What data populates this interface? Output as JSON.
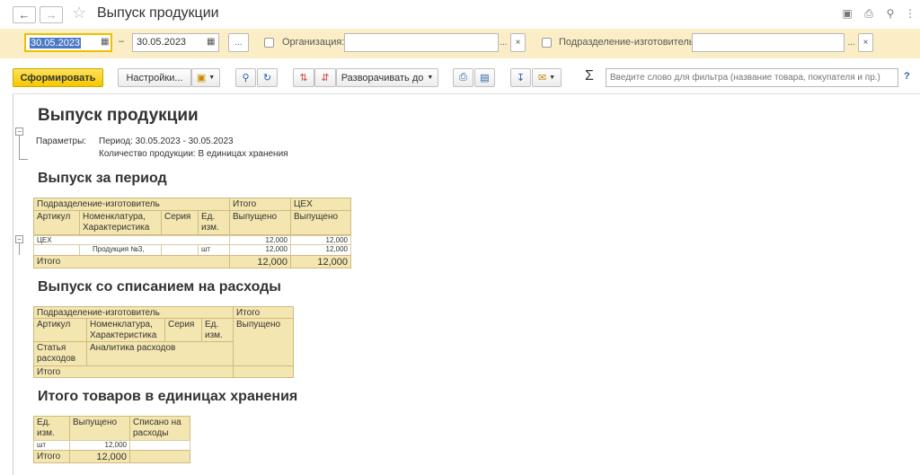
{
  "window": {
    "title": "Выпуск продукции"
  },
  "filter": {
    "date_from": "30.05.2023",
    "dash": "–",
    "date_to": "30.05.2023",
    "period_btn": "...",
    "org_label": "Организация:",
    "dept_label": "Подразделение-изготовитель:",
    "select_btn": "...",
    "clear_btn": "×"
  },
  "toolbar": {
    "generate": "Сформировать",
    "settings": "Настройки...",
    "expand_to": "Разворачивать до",
    "sigma": "Σ",
    "search_placeholder": "Введите слово для фильтра (название товара, покупателя и пр.)",
    "help": "?"
  },
  "report": {
    "title": "Выпуск продукции",
    "params_label": "Параметры:",
    "param_period": "Период: 30.05.2023 - 30.05.2023",
    "param_qty": "Количество продукции: В единицах хранения",
    "section1": {
      "title": "Выпуск за период",
      "h_dept": "Подразделение-изготовитель",
      "h_total": "Итого",
      "h_ceh": "ЦЕХ",
      "h_article": "Артикул",
      "h_nom": "Номенклатура, Характеристика",
      "h_series": "Серия",
      "h_unit": "Ед. изм.",
      "h_released1": "Выпущено",
      "h_released2": "Выпущено",
      "row_group": "ЦЕХ",
      "row_group_total": "12,000",
      "row_group_ceh": "12,000",
      "row_item_name": "Продукция №3,",
      "row_item_unit": "шт",
      "row_item_total": "12,000",
      "row_item_ceh": "12,000",
      "total_label": "Итого",
      "total_val": "12,000",
      "total_ceh": "12,000"
    },
    "section2": {
      "title": "Выпуск со списанием на расходы",
      "h_dept": "Подразделение-изготовитель",
      "h_total": "Итого",
      "h_article": "Артикул",
      "h_nom": "Номенклатура, Характеристика",
      "h_series": "Серия",
      "h_unit": "Ед. изм.",
      "h_released": "Выпущено",
      "h_expense": "Статья расходов",
      "h_analytics": "Аналитика расходов",
      "total_label": "Итого"
    },
    "section3": {
      "title": "Итого товаров в единицах хранения",
      "h_unit": "Ед. изм.",
      "h_released": "Выпущено",
      "h_written": "Списано на расходы",
      "row_unit": "шт",
      "row_val": "12,000",
      "total_label": "Итого",
      "total_val": "12,000"
    }
  }
}
